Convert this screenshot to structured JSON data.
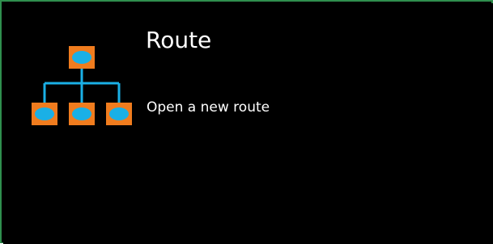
{
  "tile": {
    "title": "Route",
    "subtitle": "Open a new route",
    "icon": "route-hierarchy-icon"
  },
  "colors": {
    "background": "#000000",
    "border": "#2f8f4e",
    "node_fill": "#f07c1e",
    "node_inner": "#1ab0e6",
    "connector": "#1ab0e6",
    "text": "#ffffff"
  }
}
